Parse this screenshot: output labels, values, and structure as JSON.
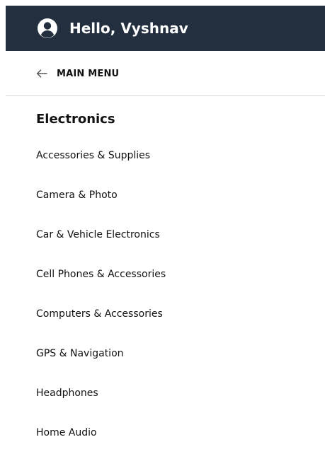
{
  "header": {
    "greeting": "Hello, Vyshnav",
    "avatar_icon": "account-circle-icon",
    "background_color": "#232f3e",
    "text_color": "#ffffff"
  },
  "back": {
    "icon": "arrow-left-icon",
    "label": "MAIN MENU"
  },
  "section": {
    "title": "Electronics"
  },
  "menu": {
    "items": [
      {
        "label": "Accessories & Supplies"
      },
      {
        "label": "Camera & Photo"
      },
      {
        "label": "Car & Vehicle Electronics"
      },
      {
        "label": "Cell Phones & Accessories"
      },
      {
        "label": "Computers & Accessories"
      },
      {
        "label": "GPS & Navigation"
      },
      {
        "label": "Headphones"
      },
      {
        "label": "Home Audio"
      }
    ]
  }
}
